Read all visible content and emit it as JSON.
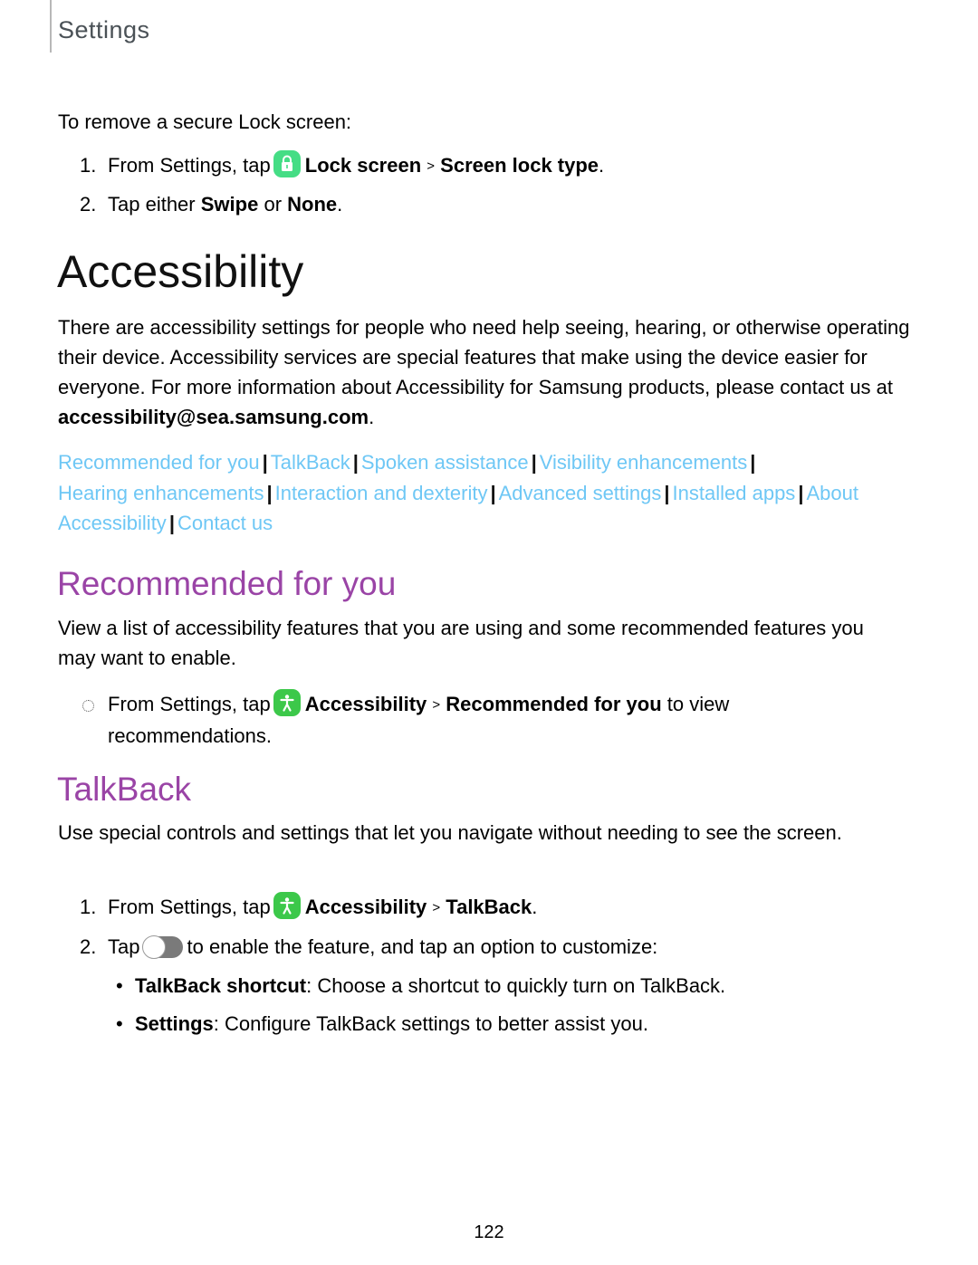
{
  "header": {
    "section": "Settings"
  },
  "lock_section": {
    "intro": "To remove a secure Lock screen:",
    "steps": [
      {
        "num": "1.",
        "pre": "From Settings, tap",
        "icon": "lock-icon",
        "bold1": "Lock screen",
        "sep": ">",
        "bold2": "Screen lock type",
        "post": "."
      },
      {
        "num": "2.",
        "pre": "Tap either",
        "bold1": "Swipe",
        "mid": "or",
        "bold2": "None",
        "post": "."
      }
    ]
  },
  "accessibility": {
    "title": "Accessibility",
    "description": "There are accessibility settings for people who need help seeing, hearing, or otherwise operating their device. Accessibility services are special features that make using the device easier for everyone. For more information about Accessibility for Samsung products, please contact us at",
    "email": "accessibility@sea.samsung.com",
    "description_end": ".",
    "links": [
      "Recommended for you",
      "TalkBack",
      "Spoken assistance",
      "Visibility enhancements",
      "Hearing enhancements",
      "Interaction and dexterity",
      "Advanced settings",
      "Installed apps",
      "About Accessibility",
      "Contact us"
    ],
    "link_separator": "|",
    "link_color": "#6ec7f5",
    "heading_color": "#9a44a6"
  },
  "recommended": {
    "title": "Recommended for you",
    "description": "View a list of accessibility features that you are using and some recommended features you may want to enable.",
    "step": {
      "pre": "From Settings, tap",
      "icon": "accessibility-icon",
      "bold1": "Accessibility",
      "sep": ">",
      "bold2": "Recommended for you",
      "post1": "to view",
      "post2": "recommendations."
    }
  },
  "talkback": {
    "title": "TalkBack",
    "description": "Use special controls and settings that let you navigate without needing to see the screen.",
    "steps": [
      {
        "num": "1.",
        "pre": "From Settings, tap",
        "icon": "accessibility-icon",
        "bold1": "Accessibility",
        "sep": ">",
        "bold2": "TalkBack",
        "post": "."
      },
      {
        "num": "2.",
        "pre": "Tap",
        "icon": "toggle-icon",
        "post": "to enable the feature, and tap an option to customize:"
      }
    ],
    "options": [
      {
        "bullet": "•",
        "label": "TalkBack shortcut",
        "text": ": Choose a shortcut to quickly turn on TalkBack."
      },
      {
        "bullet": "•",
        "label": "Settings",
        "text": ": Configure TalkBack settings to better assist you."
      }
    ]
  },
  "footer": {
    "page_number": "122"
  }
}
